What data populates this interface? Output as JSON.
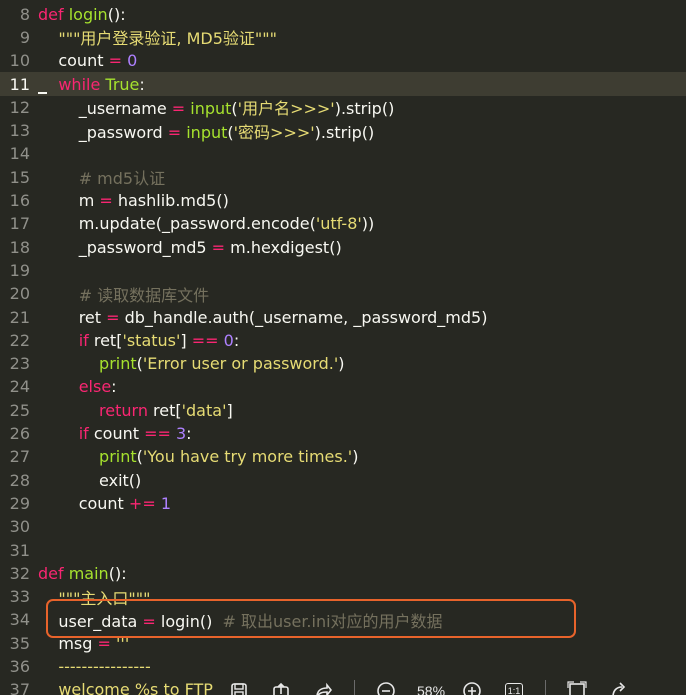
{
  "editor": {
    "lines": [
      {
        "n": "8",
        "segs": [
          [
            "kw",
            "def "
          ],
          [
            "fn",
            "login"
          ],
          [
            "p",
            "():"
          ]
        ]
      },
      {
        "n": "9",
        "segs": [
          [
            "p",
            "    "
          ],
          [
            "str",
            "\"\"\"用户登录验证, MD5验证\"\"\""
          ]
        ]
      },
      {
        "n": "10",
        "segs": [
          [
            "p",
            "    count "
          ],
          [
            "op",
            "="
          ],
          [
            "p",
            " "
          ],
          [
            "num",
            "0"
          ]
        ]
      },
      {
        "n": "11",
        "segs": [
          [
            "p",
            "    "
          ],
          [
            "kw",
            "while"
          ],
          [
            "p",
            " "
          ],
          [
            "bool",
            "True"
          ],
          [
            "p",
            ":"
          ]
        ],
        "active": true
      },
      {
        "n": "12",
        "segs": [
          [
            "p",
            "        _username "
          ],
          [
            "op",
            "="
          ],
          [
            "p",
            " "
          ],
          [
            "fn",
            "input"
          ],
          [
            "p",
            "("
          ],
          [
            "str",
            "'用户名>>>'"
          ],
          [
            "p",
            ").strip()"
          ]
        ]
      },
      {
        "n": "13",
        "segs": [
          [
            "p",
            "        _password "
          ],
          [
            "op",
            "="
          ],
          [
            "p",
            " "
          ],
          [
            "fn",
            "input"
          ],
          [
            "p",
            "("
          ],
          [
            "str",
            "'密码>>>'"
          ],
          [
            "p",
            ").strip()"
          ]
        ]
      },
      {
        "n": "14",
        "segs": []
      },
      {
        "n": "15",
        "segs": [
          [
            "cmt",
            "        # md5认证"
          ]
        ]
      },
      {
        "n": "16",
        "segs": [
          [
            "p",
            "        m "
          ],
          [
            "op",
            "="
          ],
          [
            "p",
            " hashlib.md5()"
          ]
        ]
      },
      {
        "n": "17",
        "segs": [
          [
            "p",
            "        m.update(_password.encode("
          ],
          [
            "str",
            "'utf-8'"
          ],
          [
            "p",
            "))"
          ]
        ]
      },
      {
        "n": "18",
        "segs": [
          [
            "p",
            "        _password_md5 "
          ],
          [
            "op",
            "="
          ],
          [
            "p",
            " m.hexdigest()"
          ]
        ]
      },
      {
        "n": "19",
        "segs": []
      },
      {
        "n": "20",
        "segs": [
          [
            "cmt",
            "        # 读取数据库文件"
          ]
        ]
      },
      {
        "n": "21",
        "segs": [
          [
            "p",
            "        ret "
          ],
          [
            "op",
            "="
          ],
          [
            "p",
            " db_handle.auth(_username, _password_md5)"
          ]
        ]
      },
      {
        "n": "22",
        "segs": [
          [
            "p",
            "        "
          ],
          [
            "kw",
            "if"
          ],
          [
            "p",
            " ret["
          ],
          [
            "str",
            "'status'"
          ],
          [
            "p",
            "] "
          ],
          [
            "op",
            "=="
          ],
          [
            "p",
            " "
          ],
          [
            "num",
            "0"
          ],
          [
            "p",
            ":"
          ]
        ]
      },
      {
        "n": "23",
        "segs": [
          [
            "p",
            "            "
          ],
          [
            "fn",
            "print"
          ],
          [
            "p",
            "("
          ],
          [
            "str",
            "'Error user or password.'"
          ],
          [
            "p",
            ")"
          ]
        ]
      },
      {
        "n": "24",
        "segs": [
          [
            "p",
            "        "
          ],
          [
            "kw",
            "else"
          ],
          [
            "p",
            ":"
          ]
        ]
      },
      {
        "n": "25",
        "segs": [
          [
            "p",
            "            "
          ],
          [
            "kw",
            "return"
          ],
          [
            "p",
            " ret["
          ],
          [
            "str",
            "'data'"
          ],
          [
            "p",
            "]"
          ]
        ]
      },
      {
        "n": "26",
        "segs": [
          [
            "p",
            "        "
          ],
          [
            "kw",
            "if"
          ],
          [
            "p",
            " count "
          ],
          [
            "op",
            "=="
          ],
          [
            "p",
            " "
          ],
          [
            "num",
            "3"
          ],
          [
            "p",
            ":"
          ]
        ]
      },
      {
        "n": "27",
        "segs": [
          [
            "p",
            "            "
          ],
          [
            "fn",
            "print"
          ],
          [
            "p",
            "("
          ],
          [
            "str",
            "'You have try more times.'"
          ],
          [
            "p",
            ")"
          ]
        ]
      },
      {
        "n": "28",
        "segs": [
          [
            "p",
            "            exit()"
          ]
        ]
      },
      {
        "n": "29",
        "segs": [
          [
            "p",
            "        count "
          ],
          [
            "op",
            "+="
          ],
          [
            "p",
            " "
          ],
          [
            "num",
            "1"
          ]
        ]
      },
      {
        "n": "30",
        "segs": []
      },
      {
        "n": "31",
        "segs": []
      },
      {
        "n": "32",
        "segs": [
          [
            "kw",
            "def "
          ],
          [
            "fn",
            "main"
          ],
          [
            "p",
            "():"
          ]
        ]
      },
      {
        "n": "33",
        "segs": [
          [
            "p",
            "    "
          ],
          [
            "str",
            "\"\"\"主入口\"\"\""
          ]
        ]
      },
      {
        "n": "34",
        "segs": [
          [
            "p",
            "    user_data "
          ],
          [
            "op",
            "="
          ],
          [
            "p",
            " login()  "
          ],
          [
            "cmt",
            "# 取出user.ini对应的用户数据"
          ]
        ]
      },
      {
        "n": "35",
        "segs": [
          [
            "p",
            "    msg "
          ],
          [
            "op",
            "="
          ],
          [
            "p",
            " "
          ],
          [
            "str",
            "'''"
          ]
        ]
      },
      {
        "n": "36",
        "segs": [
          [
            "str",
            "    ----------------"
          ]
        ]
      },
      {
        "n": "37",
        "segs": [
          [
            "str",
            "    welcome %s to FTP"
          ]
        ]
      }
    ]
  },
  "toolbar": {
    "zoom_label": "58%",
    "ratio_label": "1:1",
    "icons": [
      "save-icon",
      "share-icon",
      "forward-icon",
      "zoom-out-icon",
      "zoom-in-icon",
      "actual-size-icon",
      "fit-icon",
      "rotate-icon"
    ]
  },
  "colors": {
    "background": "#272822",
    "keyword": "#f92672",
    "function": "#a6e22e",
    "string": "#e6db74",
    "number": "#ae81ff",
    "comment": "#75715e",
    "highlight_box": "#e8632b"
  }
}
